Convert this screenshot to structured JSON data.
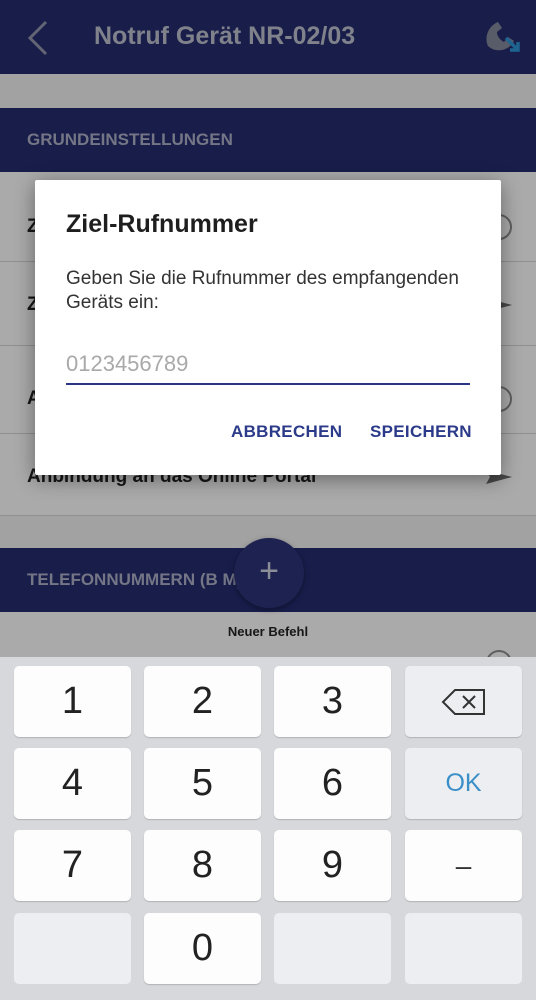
{
  "appbar": {
    "title": "Notruf Gerät NR-02/03",
    "back_icon": "chevron-left-icon",
    "call_icon": "phone-forward-icon"
  },
  "sections": {
    "basic": {
      "title": "GRUNDEINSTELLUNGEN"
    },
    "phones": {
      "title": "TELEFONNUMMERN (B    M)"
    }
  },
  "rows": {
    "row1_label": "Z",
    "row2_label": "Z",
    "row3_label": "A",
    "row4_label": "Anbindung an das Online Portal"
  },
  "fab": {
    "icon": "+",
    "caption": "Neuer Befehl"
  },
  "dialog": {
    "title": "Ziel-Rufnummer",
    "message": "Geben Sie die Rufnummer des empfangenden Geräts ein:",
    "input_value": "",
    "input_placeholder": "0123456789",
    "cancel_label": "ABBRECHEN",
    "save_label": "SPEICHERN"
  },
  "keypad": {
    "keys": [
      "1",
      "2",
      "3",
      "4",
      "5",
      "6",
      "7",
      "8",
      "9",
      "0"
    ],
    "ok_label": "OK",
    "dash_label": "–",
    "backspace_icon": "backspace-icon"
  },
  "colors": {
    "primary": "#232a6b",
    "accent": "#2c3a8a",
    "ok_blue": "#3a8fc9"
  }
}
